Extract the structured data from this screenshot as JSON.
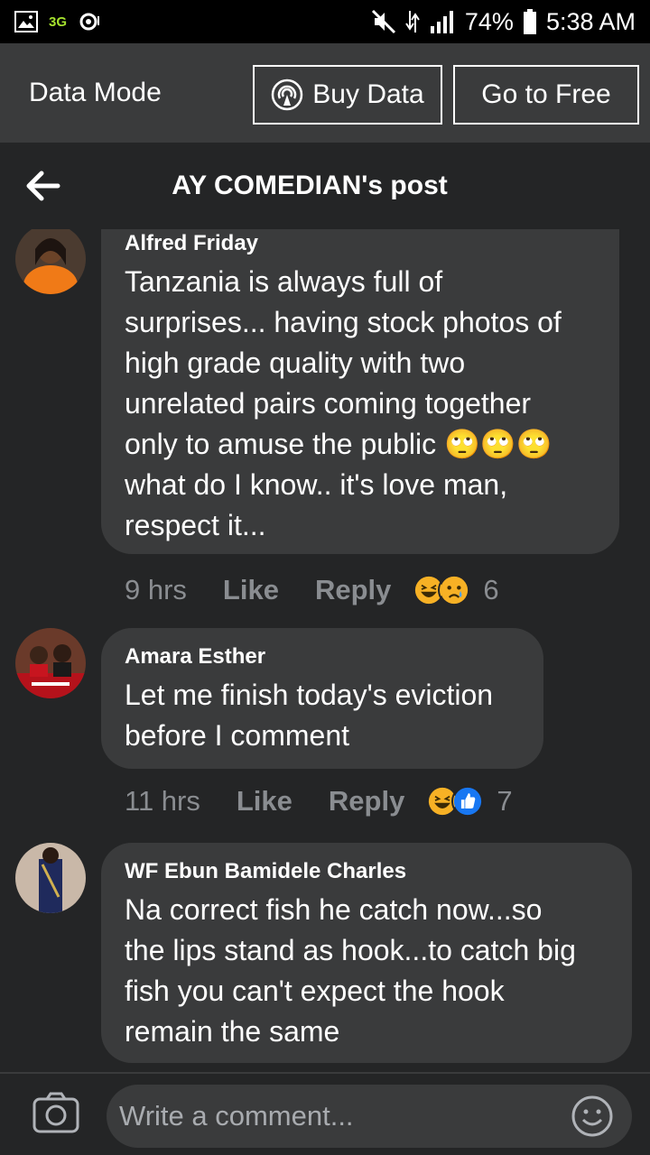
{
  "status": {
    "network": "3G",
    "battery": "74%",
    "time": "5:38 AM"
  },
  "data_mode": {
    "label": "Data Mode",
    "buy_label": "Buy Data",
    "free_label": "Go to Free"
  },
  "header": {
    "title": "AY COMEDIAN's post"
  },
  "comments": [
    {
      "author": "Alfred Friday",
      "text": "Tanzania is always full of\nsurprises... having stock photos of\nhigh grade quality with two\nunrelated pairs coming together\nonly to amuse the public 🙄🙄🙄\nwhat do I know.. it's  love man,\nrespect it...",
      "time": "9 hrs",
      "like": "Like",
      "reply": "Reply",
      "reaction_count": "6",
      "reactions": [
        "haha",
        "sad"
      ]
    },
    {
      "author": "Amara Esther",
      "text": "Let me finish today's eviction\nbefore I comment",
      "time": "11 hrs",
      "like": "Like",
      "reply": "Reply",
      "reaction_count": "7",
      "reactions": [
        "haha",
        "like"
      ]
    },
    {
      "author": "WF Ebun Bamidele Charles",
      "text": "Na correct fish he catch now...so\nthe lips stand as hook...to catch big\nfish you can't expect the hook\nremain the same"
    }
  ],
  "composer": {
    "placeholder": "Write a comment..."
  },
  "colors": {
    "background": "#242526",
    "bubble": "#3a3b3c",
    "muted": "#8a8d91",
    "haha": "#f7b125",
    "like": "#1877f2"
  }
}
